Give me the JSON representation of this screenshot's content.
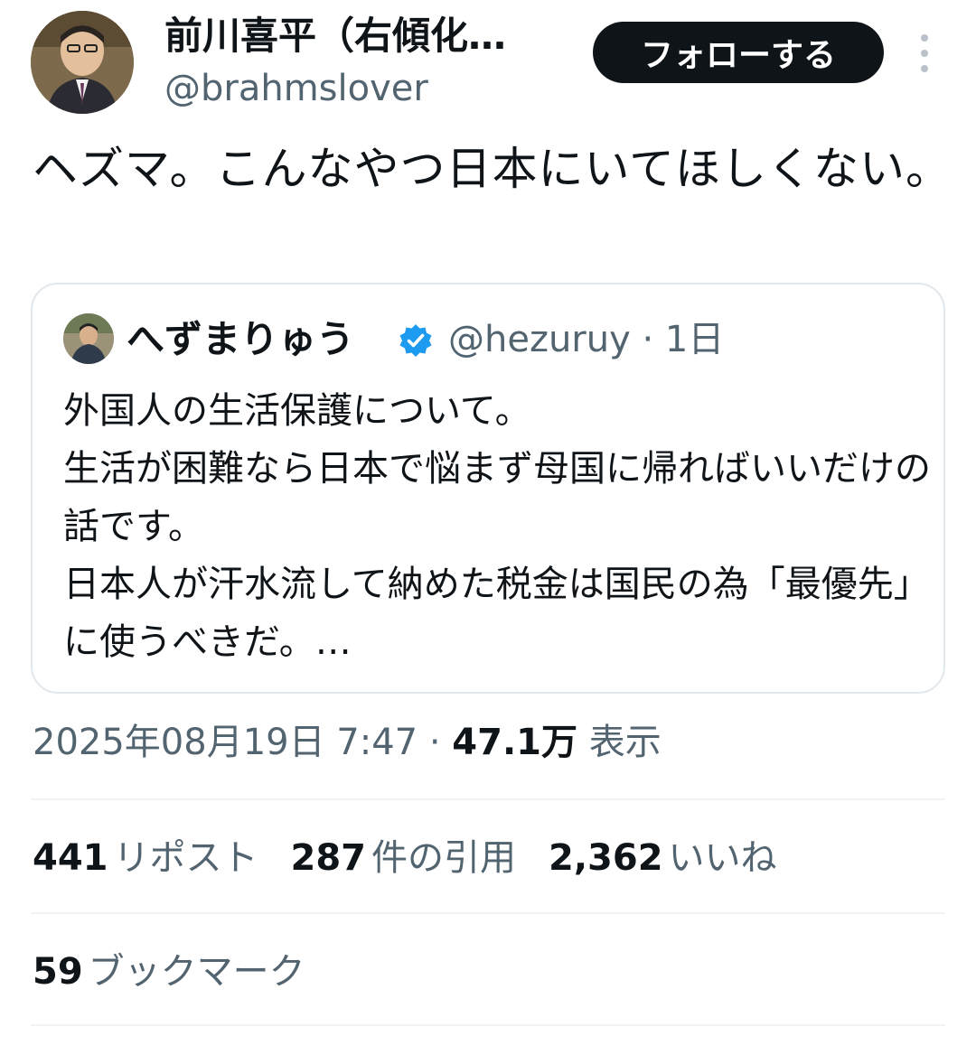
{
  "author": {
    "display_name": "前川喜平（右傾化…",
    "handle": "@brahmslover",
    "avatar_icon": "avatar-photo-icon"
  },
  "follow_button": {
    "label": "フォローする"
  },
  "more_icon": "more-vertical-icon",
  "tweet": {
    "text": "ヘズマ。こんなやつ日本にいてほしくない。"
  },
  "quoted_tweet": {
    "display_name": "へずまりゅう",
    "verified_icon": "verified-badge-icon",
    "handle_time": "@hezuruy · 1日",
    "text": "外国人の生活保護について。\n生活が困難なら日本で悩まず母国に帰ればいいだけの話です。\n日本人が汗水流して納めた税金は国民の為「最優先」に使うべきだ。…"
  },
  "meta": {
    "datetime": "2025年08月19日 7:47 · ",
    "views_count": "47.1万",
    "views_label": " 表示"
  },
  "stats": {
    "reposts": {
      "count": "441",
      "label": "リポスト"
    },
    "quotes": {
      "count": "287",
      "label": "件の引用"
    },
    "likes": {
      "count": "2,362",
      "label": "いいね"
    }
  },
  "bookmarks": {
    "count": "59",
    "label": "ブックマーク"
  },
  "colors": {
    "text_primary": "#0f1419",
    "text_secondary": "#536471",
    "border": "#e1e8ed",
    "verified_blue": "#1d9bf0",
    "button_bg": "#0f1419"
  }
}
